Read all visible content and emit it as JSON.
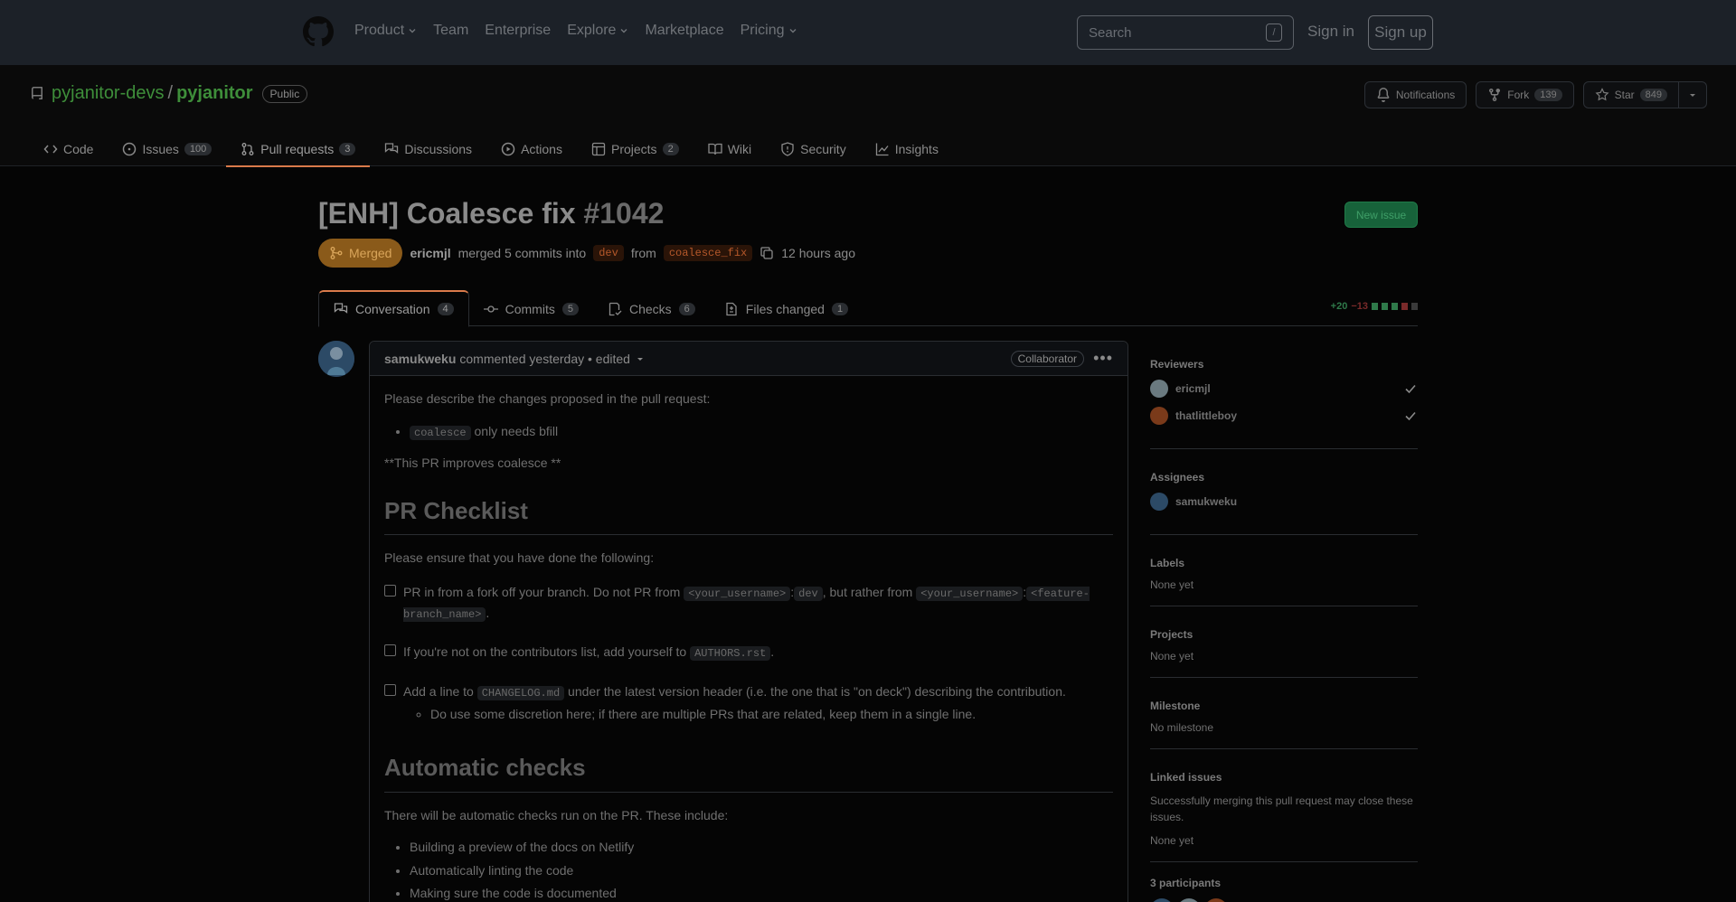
{
  "topnav": {
    "items": [
      {
        "label": "Product",
        "dropdown": true
      },
      {
        "label": "Team",
        "dropdown": false
      },
      {
        "label": "Enterprise",
        "dropdown": false
      },
      {
        "label": "Explore",
        "dropdown": true
      },
      {
        "label": "Marketplace",
        "dropdown": false
      },
      {
        "label": "Pricing",
        "dropdown": true
      }
    ],
    "search_placeholder": "Search",
    "search_shortcut": "/",
    "signin": "Sign in",
    "signup": "Sign up"
  },
  "repo": {
    "owner": "pyjanitor-devs",
    "separator": "/",
    "name": "pyjanitor",
    "visibility": "Public",
    "notifications_label": "Notifications",
    "fork_label": "Fork",
    "fork_count": "139",
    "star_label": "Star",
    "star_count": "849",
    "tabs": [
      {
        "label": "Code",
        "count": ""
      },
      {
        "label": "Issues",
        "count": "100"
      },
      {
        "label": "Pull requests",
        "count": "3"
      },
      {
        "label": "Discussions",
        "count": ""
      },
      {
        "label": "Actions",
        "count": ""
      },
      {
        "label": "Projects",
        "count": "2"
      },
      {
        "label": "Wiki",
        "count": ""
      },
      {
        "label": "Security",
        "count": ""
      },
      {
        "label": "Insights",
        "count": ""
      }
    ]
  },
  "pr": {
    "title": "[ENH] Coalesce fix",
    "number": "#1042",
    "new_issue": "New issue",
    "state": "Merged",
    "author": "ericmjl",
    "merged_text": "merged 5 commits into",
    "base_branch": "dev",
    "from_text": "from",
    "head_branch": "coalesce_fix",
    "time": "12 hours ago",
    "tabs": [
      {
        "label": "Conversation",
        "count": "4"
      },
      {
        "label": "Commits",
        "count": "5"
      },
      {
        "label": "Checks",
        "count": "6"
      },
      {
        "label": "Files changed",
        "count": "1"
      }
    ],
    "additions": "+20",
    "deletions": "−13"
  },
  "comment": {
    "author": "samukweku",
    "action": "commented yesterday • edited",
    "role": "Collaborator",
    "intro": "Please describe the changes proposed in the pull request:",
    "bullet_code": "coalesce",
    "bullet_text": "only needs bfill",
    "bold_note": "**This PR improves coalesce **",
    "h_checklist": "PR Checklist",
    "ensure": "Please ensure that you have done the following:",
    "task1_a": "PR in from a fork off your branch. Do not PR from",
    "task1_c1": "<your_username>",
    "task1_colon1": ":",
    "task1_c2": "dev",
    "task1_b": ", but rather from",
    "task1_c3": "<your_username>",
    "task1_colon2": ":",
    "task1_c4": "<feature-branch_name>",
    "task1_end": ".",
    "task2_a": "If you're not on the contributors list, add yourself to",
    "task2_c": "AUTHORS.rst",
    "task2_end": ".",
    "task3_a": "Add a line to",
    "task3_c": "CHANGELOG.md",
    "task3_b": "under the latest version header (i.e. the one that is \"on deck\") describing the contribution.",
    "task3_sub": "Do use some discretion here; if there are multiple PRs that are related, keep them in a single line.",
    "h_auto": "Automatic checks",
    "auto_intro": "There will be automatic checks run on the PR. These include:",
    "auto_items": [
      "Building a preview of the docs on Netlify",
      "Automatically linting the code",
      "Making sure the code is documented"
    ]
  },
  "sidebar": {
    "reviewers_title": "Reviewers",
    "reviewers": [
      "ericmjl",
      "thatlittleboy"
    ],
    "assignees_title": "Assignees",
    "assignees": [
      "samukweku"
    ],
    "labels_title": "Labels",
    "labels_value": "None yet",
    "projects_title": "Projects",
    "projects_value": "None yet",
    "milestone_title": "Milestone",
    "milestone_value": "No milestone",
    "linked_title": "Linked issues",
    "linked_desc": "Successfully merging this pull request may close these issues.",
    "linked_value": "None yet",
    "participants_title": "3 participants"
  },
  "colors": {
    "accent_tab": "#d97a4a",
    "merged_badge": "#8a5a1a",
    "new_issue": "#17623a",
    "repo_link": "#3e8e3a"
  }
}
